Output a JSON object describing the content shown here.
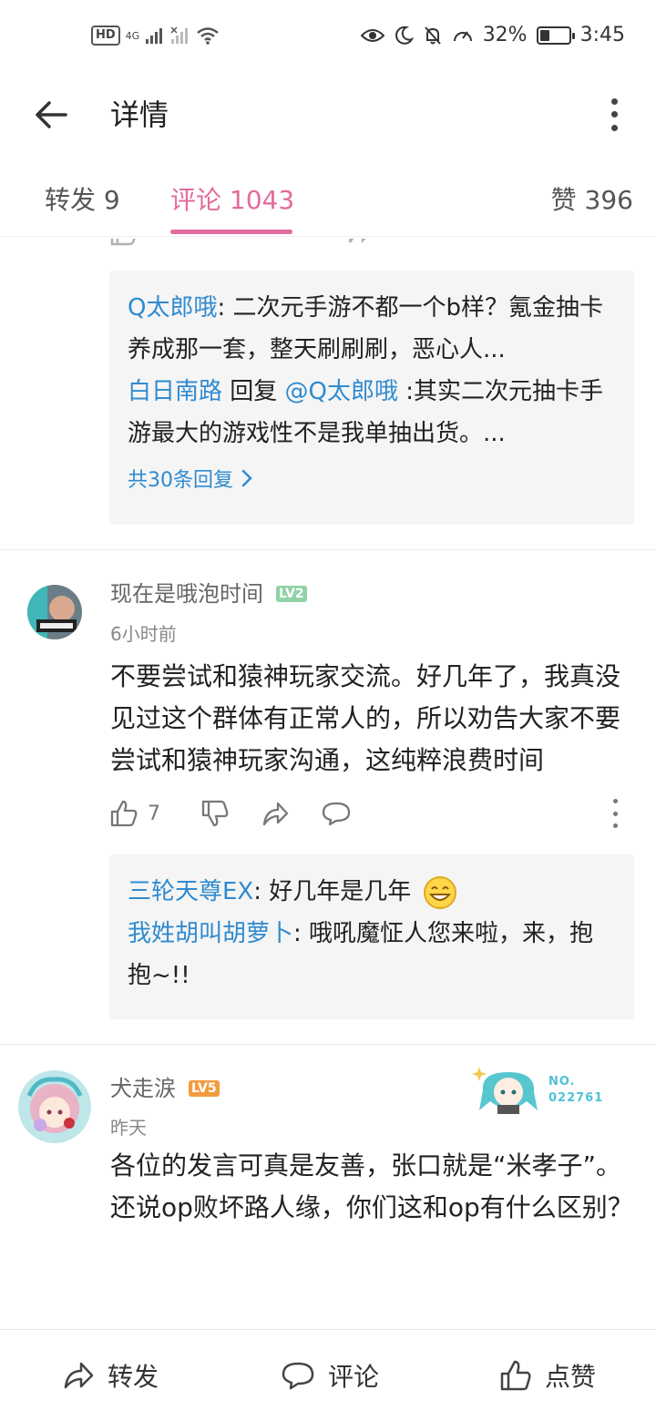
{
  "status_bar": {
    "hd": "HD",
    "network": "4G",
    "battery_percent": "32%",
    "battery_level": 0.32,
    "time": "3:45"
  },
  "header": {
    "title": "详情",
    "back_icon": "arrow-left-icon",
    "more_icon": "more-vertical-icon"
  },
  "tabs": {
    "repost": "转发 9",
    "comments": "评论 1043",
    "likes": "赞 396",
    "active": "comments",
    "accent": "#e56a9d"
  },
  "thread1_replies": {
    "r1_user": "Q太郎哦",
    "r1_text": ": 二次元手游不都一个b样？氪金抽卡养成那一套，整天刷刷刷，恶心人...",
    "r2_user": "白日南路",
    "r2_mid": " 回复 ",
    "r2_at": "@Q太郎哦",
    "r2_text": " :其实二次元抽卡手游最大的游戏性不是我单抽出货。...",
    "more_label": "共30条回复"
  },
  "comment1": {
    "author": "现在是哦泡时间",
    "level": "LV2",
    "time": "6小时前",
    "text": "不要尝试和猿神玩家交流。好几年了，我真没见过这个群体有正常人的，所以劝告大家不要尝试和猿神玩家沟通，这纯粹浪费时间",
    "like_count": "7",
    "replies": {
      "r1_user": "三轮天尊EX",
      "r1_text": ": 好几年是几年",
      "r2_user": "我姓胡叫胡萝卜",
      "r2_text": ": 哦吼魔怔人您来啦，来，抱抱~!!"
    }
  },
  "comment2": {
    "author": "犬走涙",
    "level": "LV5",
    "time": "昨天",
    "badge_no": "NO. 022761",
    "text_line1": "各位的发言可真是友善，张口就是“米孝子”。",
    "text_line2": "还说op败坏路人缘，你们这和op有什么区别？"
  },
  "bottom_bar": {
    "repost": "转发",
    "comment": "评论",
    "like": "点赞"
  },
  "colors": {
    "link_blue": "#2f8bd0",
    "pink": "#e56a9d",
    "reply_bg": "#f5f5f5"
  }
}
